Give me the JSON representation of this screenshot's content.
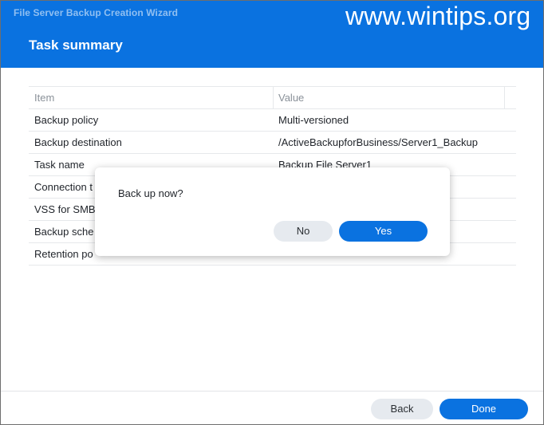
{
  "window": {
    "title": "File Server Backup Creation Wizard",
    "watermark": "www.wintips.org",
    "heading": "Task summary"
  },
  "table": {
    "headers": [
      "Item",
      "Value"
    ],
    "rows": [
      {
        "item": "Backup policy",
        "value": "Multi-versioned"
      },
      {
        "item": "Backup destination",
        "value": "/ActiveBackupforBusiness/Server1_Backup"
      },
      {
        "item": "Task name",
        "value": "Backup File Server1"
      },
      {
        "item": "Connection t",
        "value": ""
      },
      {
        "item": "VSS for SMB",
        "value": ""
      },
      {
        "item": "Backup sche",
        "value": ""
      },
      {
        "item": "Retention po",
        "value": ""
      }
    ]
  },
  "footer": {
    "back_label": "Back",
    "done_label": "Done"
  },
  "dialog": {
    "message": "Back up now?",
    "no_label": "No",
    "yes_label": "Yes"
  },
  "colors": {
    "accent": "#0a72e0",
    "secondary_button": "#e6eaef",
    "text": "#1f2329",
    "muted_text": "#8a9199"
  }
}
